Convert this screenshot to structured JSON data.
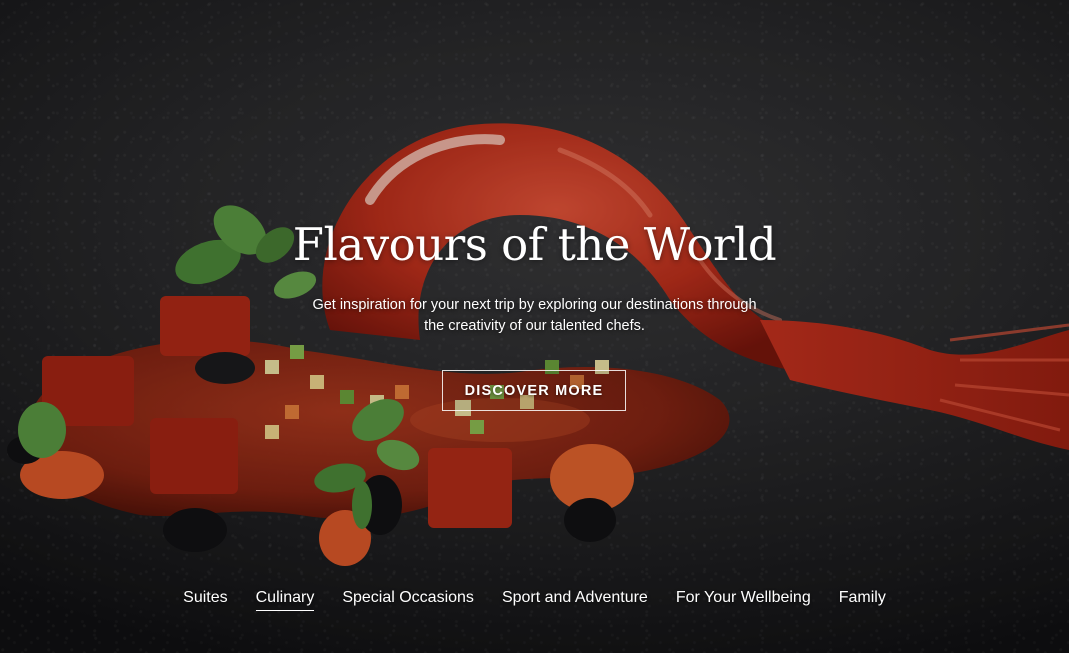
{
  "hero": {
    "title": "Flavours of the World",
    "subtitle": "Get inspiration for your next trip by exploring our destinations through the creativity of our talented chefs.",
    "cta_label": "DISCOVER MORE",
    "image_subject": "prawn-dish-on-dark-stone"
  },
  "nav": {
    "items": [
      {
        "label": "Suites",
        "active": false
      },
      {
        "label": "Culinary",
        "active": true
      },
      {
        "label": "Special Occasions",
        "active": false
      },
      {
        "label": "Sport and Adventure",
        "active": false
      },
      {
        "label": "For Your Wellbeing",
        "active": false
      },
      {
        "label": "Family",
        "active": false
      }
    ]
  },
  "colors": {
    "background": "#1c1c1e",
    "prawn": "#c8321f",
    "sauce": "#8e1f12",
    "herb": "#4e8a3a",
    "text": "#ffffff"
  }
}
